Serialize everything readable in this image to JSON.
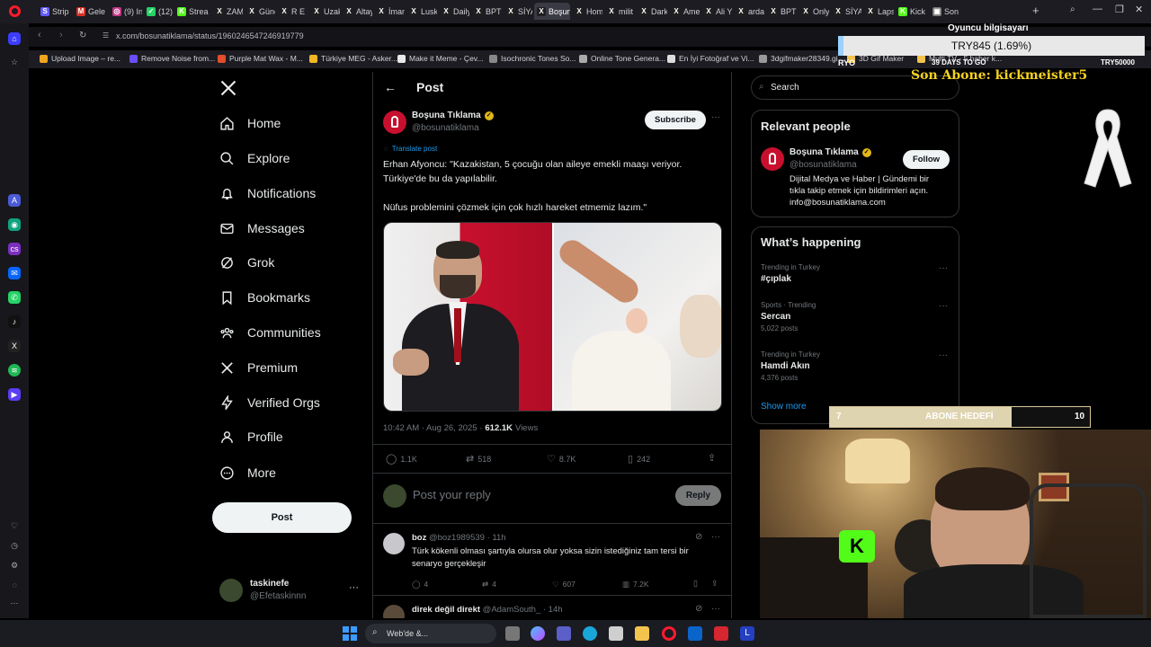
{
  "browser": {
    "tabs": [
      {
        "label": "Strip",
        "color": "#635bff",
        "glyph": "S"
      },
      {
        "label": "Gele",
        "color": "#d93025",
        "glyph": "M"
      },
      {
        "label": "(9) In",
        "color": "#c13584",
        "glyph": "◎"
      },
      {
        "label": "(12)",
        "color": "#25d366",
        "glyph": "✓"
      },
      {
        "label": "Strea",
        "color": "#53fc18",
        "glyph": "K"
      },
      {
        "label": "ZAM",
        "color": "#1f1f1f",
        "glyph": "X"
      },
      {
        "label": "Güne",
        "color": "#1f1f1f",
        "glyph": "X"
      },
      {
        "label": "R E N",
        "color": "#1f1f1f",
        "glyph": "X"
      },
      {
        "label": "Uzak",
        "color": "#1f1f1f",
        "glyph": "X"
      },
      {
        "label": "Altay",
        "color": "#1f1f1f",
        "glyph": "X"
      },
      {
        "label": "İman",
        "color": "#1f1f1f",
        "glyph": "X"
      },
      {
        "label": "Lusk",
        "color": "#1f1f1f",
        "glyph": "X"
      },
      {
        "label": "Daily",
        "color": "#1f1f1f",
        "glyph": "X"
      },
      {
        "label": "BPT",
        "color": "#1f1f1f",
        "glyph": "X"
      },
      {
        "label": "SİYA",
        "color": "#1f1f1f",
        "glyph": "X"
      },
      {
        "label": "Boşuna T",
        "color": "#1f1f1f",
        "glyph": "X"
      },
      {
        "label": "Hom",
        "color": "#1f1f1f",
        "glyph": "X"
      },
      {
        "label": "milit",
        "color": "#1f1f1f",
        "glyph": "X"
      },
      {
        "label": "Dark",
        "color": "#1f1f1f",
        "glyph": "X"
      },
      {
        "label": "Ame",
        "color": "#1f1f1f",
        "glyph": "X"
      },
      {
        "label": "Ali Yı",
        "color": "#1f1f1f",
        "glyph": "X"
      },
      {
        "label": "arda",
        "color": "#1f1f1f",
        "glyph": "X"
      },
      {
        "label": "BPT",
        "color": "#1f1f1f",
        "glyph": "X"
      },
      {
        "label": "Only",
        "color": "#1f1f1f",
        "glyph": "X"
      },
      {
        "label": "SİYA",
        "color": "#1f1f1f",
        "glyph": "X"
      },
      {
        "label": "Laps",
        "color": "#1f1f1f",
        "glyph": "X"
      },
      {
        "label": "Kick",
        "color": "#53fc18",
        "glyph": "K"
      },
      {
        "label": "Son",
        "color": "#777777",
        "glyph": "▣"
      }
    ],
    "url": "x.com/bosunatiklama/status/1960246547246919779",
    "bookmarks": [
      "Upload Image – re...",
      "Remove Noise from...",
      "Purple Mat Wax - M...",
      "Türkiye MEG - Asker...",
      "Make it Meme - Çev...",
      "Isochronic Tones So...",
      "Online Tone Genera...",
      "En İyi Fotoğraf ve Vi...",
      "3dgifmaker28349.gi...",
      "3D Gif Maker",
      "Multi TV - 5 haber k..."
    ]
  },
  "nav": {
    "items": [
      "Home",
      "Explore",
      "Notifications",
      "Messages",
      "Grok",
      "Bookmarks",
      "Communities",
      "Premium",
      "Verified Orgs",
      "Profile",
      "More"
    ],
    "post_button": "Post",
    "account": {
      "name": "taskinefe",
      "handle": "@Efetaskinnn"
    }
  },
  "main": {
    "header_title": "Post",
    "author_name": "Boşuna Tıklama",
    "author_handle": "@bosunatiklama",
    "subscribe_label": "Subscribe",
    "translate_label": "Translate post",
    "text_line1": "Erhan Afyoncu: \"Kazakistan, 5 çocuğu olan aileye emekli maaşı veriyor.",
    "text_line2": "Türkiye'de bu da yapılabilir.",
    "text_line3": "Nüfus problemini çözmek için çok hızlı hareket etmemiz lazım.\"",
    "time": "10:42 AM · Aug 26, 2025 ·",
    "views_count": "612.1K",
    "views_label": "Views",
    "stats": {
      "replies": "1.1K",
      "reposts": "518",
      "likes": "8.7K",
      "bookmarks": "242"
    },
    "reply_placeholder": "Post your reply",
    "reply_button": "Reply",
    "reply1": {
      "name": "boz",
      "handle": "@boz1989539 · 11h",
      "text1": "Türk kökenli olması şartıyla olursa olur yoksa sizin istediğiniz tam tersi bir",
      "text2": "senaryo gerçekleşir",
      "replies": "4",
      "reposts": "4",
      "likes": "607",
      "views": "7.2K"
    },
    "reply2": {
      "name": "direk değil direkt",
      "handle": "@AdamSouth_ · 14h"
    }
  },
  "right": {
    "search_placeholder": "Search",
    "relevant_title": "Relevant people",
    "person_name": "Boşuna Tıklama",
    "person_handle": "@bosunatiklama",
    "follow_label": "Follow",
    "bio1": "Dijital Medya ve Haber | Gündemi bir",
    "bio2": "tıkla takip etmek için bildirimleri açın.",
    "bio3": "info@bosunatiklama.com",
    "happening_title": "What’s happening",
    "trends": [
      {
        "meta": "Trending in Turkey",
        "title": "#çıplak",
        "posts": ""
      },
      {
        "meta": "Sports · Trending",
        "title": "Sercan",
        "posts": "5,022 posts"
      },
      {
        "meta": "Trending in Turkey",
        "title": "Hamdi Akın",
        "posts": "4,376 posts"
      }
    ],
    "show_more": "Show more"
  },
  "stream_overlay": {
    "goal_title": "Oyuncu bilgisayarı",
    "goal_amount": "TRY845 (1.69%)",
    "goal_start": "RYO",
    "goal_days": "39 DAYS TO GO",
    "goal_target": "TRY50000",
    "last_sub": "Son Abone: kickmeister5",
    "sub_goal_current": "7",
    "sub_goal_label": "ABONE HEDEFİ",
    "sub_goal_target": "10",
    "sub_goal_progress": 0.7
  },
  "taskbar": {
    "search_label": "Web'de &..."
  }
}
